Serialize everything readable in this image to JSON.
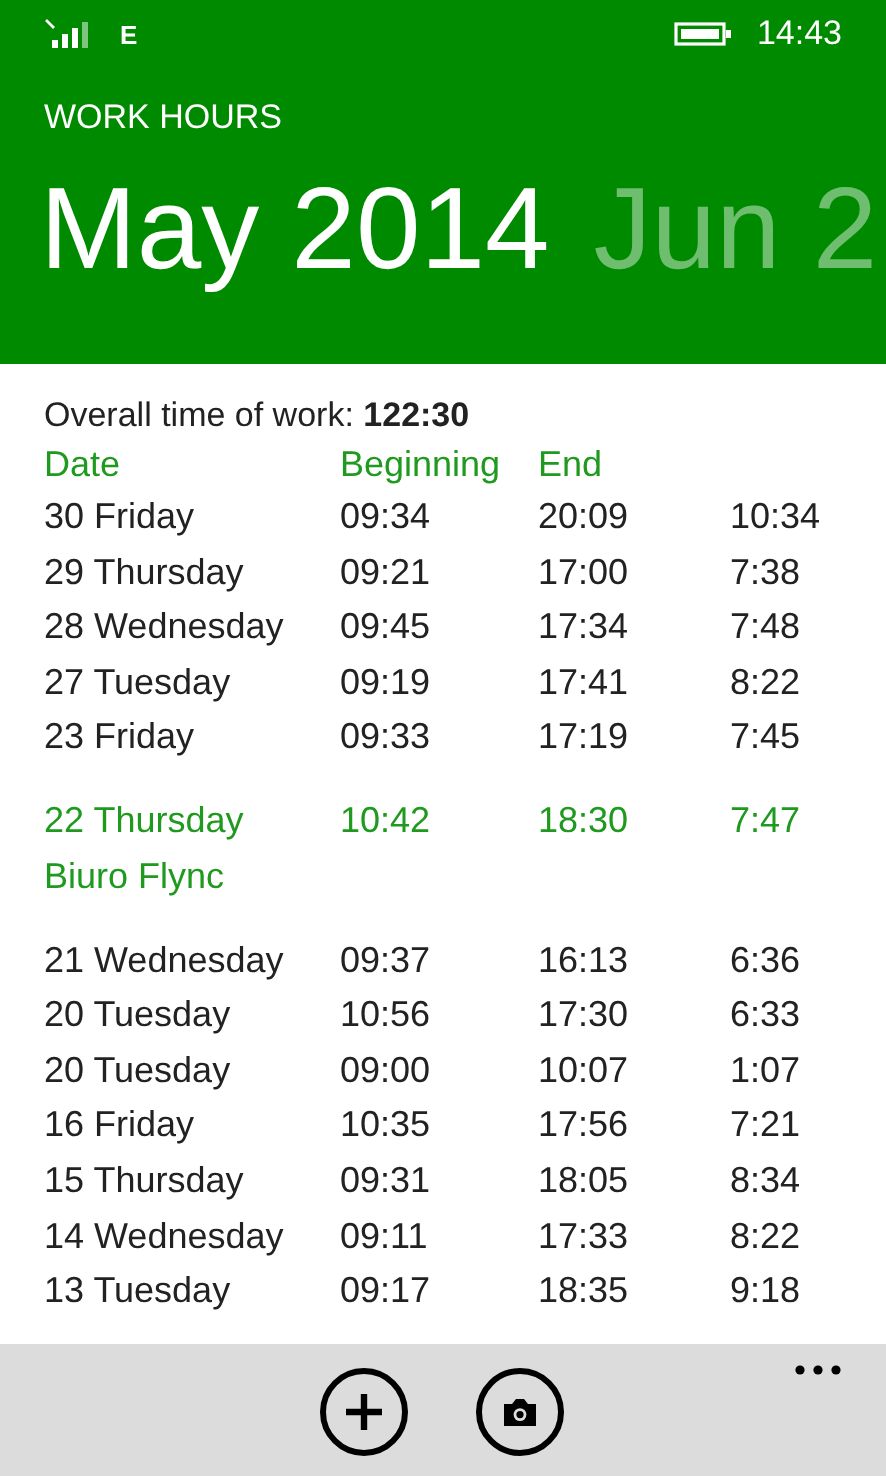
{
  "status_bar": {
    "network": "E",
    "time": "14:43"
  },
  "app_title": "WORK HOURS",
  "pivots": [
    {
      "label": "May 2014",
      "selected": true
    },
    {
      "label": "Jun 2",
      "selected": false
    }
  ],
  "summary": {
    "label": "Overall time of work: ",
    "value": "122:30"
  },
  "table": {
    "columns": [
      "Date",
      "Beginning",
      "End"
    ],
    "rows": [
      {
        "date": "30 Friday",
        "beginning": "09:34",
        "end": "20:09",
        "duration": "10:34",
        "highlighted": false
      },
      {
        "date": "29 Thursday",
        "beginning": "09:21",
        "end": "17:00",
        "duration": "7:38",
        "highlighted": false
      },
      {
        "date": "28 Wednesday",
        "beginning": "09:45",
        "end": "17:34",
        "duration": "7:48",
        "highlighted": false
      },
      {
        "date": "27 Tuesday",
        "beginning": "09:19",
        "end": "17:41",
        "duration": "8:22",
        "highlighted": false
      },
      {
        "date": "23 Friday",
        "beginning": "09:33",
        "end": "17:19",
        "duration": "7:45",
        "highlighted": false
      },
      {
        "date": "22 Thursday",
        "beginning": "10:42",
        "end": "18:30",
        "duration": "7:47",
        "highlighted": true,
        "note": "Biuro Flync"
      },
      {
        "date": "21 Wednesday",
        "beginning": "09:37",
        "end": "16:13",
        "duration": "6:36",
        "highlighted": false
      },
      {
        "date": "20 Tuesday",
        "beginning": "10:56",
        "end": "17:30",
        "duration": "6:33",
        "highlighted": false
      },
      {
        "date": "20 Tuesday",
        "beginning": "09:00",
        "end": "10:07",
        "duration": "1:07",
        "highlighted": false
      },
      {
        "date": "16 Friday",
        "beginning": "10:35",
        "end": "17:56",
        "duration": "7:21",
        "highlighted": false
      },
      {
        "date": "15 Thursday",
        "beginning": "09:31",
        "end": "18:05",
        "duration": "8:34",
        "highlighted": false
      },
      {
        "date": "14 Wednesday",
        "beginning": "09:11",
        "end": "17:33",
        "duration": "8:22",
        "highlighted": false
      },
      {
        "date": "13 Tuesday",
        "beginning": "09:17",
        "end": "18:35",
        "duration": "9:18",
        "highlighted": false
      }
    ]
  },
  "app_bar": {
    "buttons": [
      {
        "kind": "add"
      },
      {
        "kind": "camera"
      }
    ]
  }
}
